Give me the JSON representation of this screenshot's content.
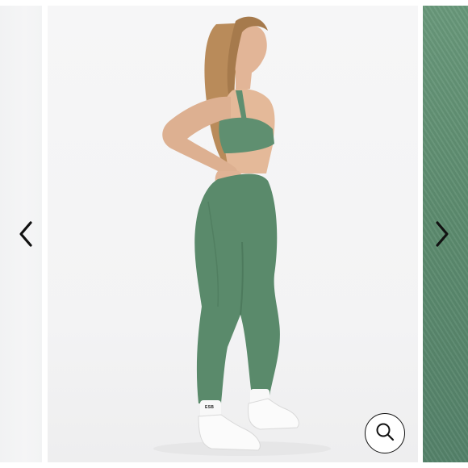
{
  "gallery": {
    "sock_logo_text": "ESB",
    "prev_arrow_icon": "chevron-left-icon",
    "next_arrow_icon": "chevron-right-icon",
    "zoom_icon": "magnifier-icon"
  },
  "colors": {
    "product_green": "#5a8a6b",
    "next_slide_fabric": "#5d8c6f",
    "background": "#f5f5f6",
    "icon_color": "#111111"
  }
}
